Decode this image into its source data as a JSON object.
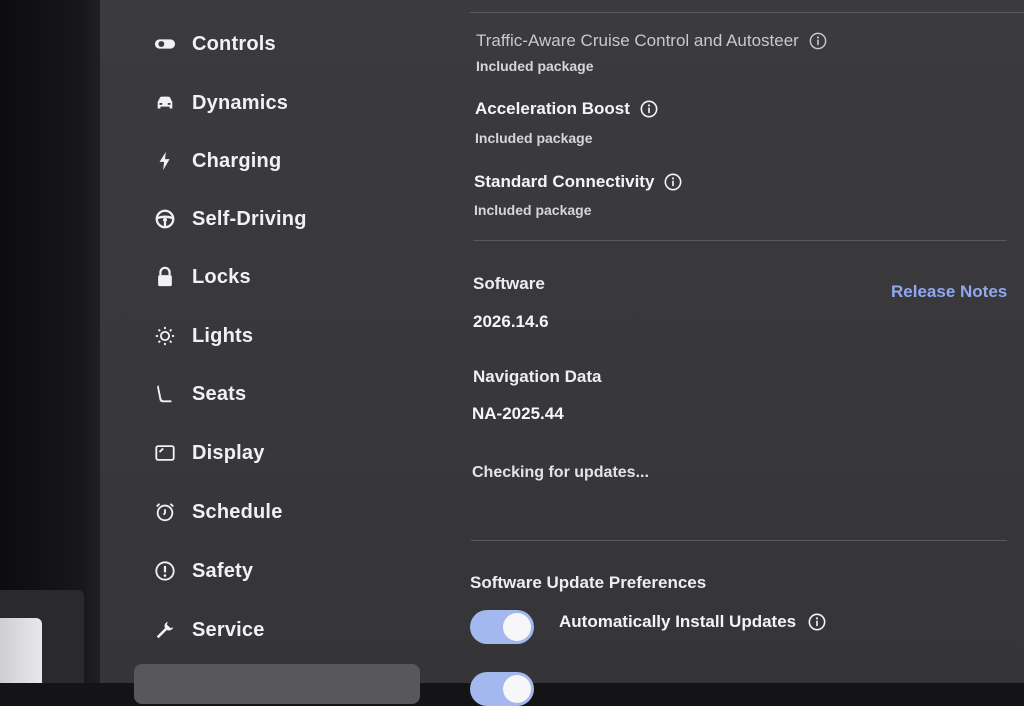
{
  "sidebar": {
    "items": [
      {
        "label": "Controls",
        "icon": "toggle-icon"
      },
      {
        "label": "Dynamics",
        "icon": "car-icon"
      },
      {
        "label": "Charging",
        "icon": "lightning-icon"
      },
      {
        "label": "Self-Driving",
        "icon": "steering-wheel-icon"
      },
      {
        "label": "Locks",
        "icon": "lock-icon"
      },
      {
        "label": "Lights",
        "icon": "light-bulb-icon"
      },
      {
        "label": "Seats",
        "icon": "seat-icon"
      },
      {
        "label": "Display",
        "icon": "display-icon"
      },
      {
        "label": "Schedule",
        "icon": "alarm-clock-icon"
      },
      {
        "label": "Safety",
        "icon": "alert-circle-icon"
      },
      {
        "label": "Service",
        "icon": "wrench-icon"
      }
    ]
  },
  "features": [
    {
      "title": "Traffic-Aware Cruise Control and Autosteer",
      "subtitle": "Included package"
    },
    {
      "title": "Acceleration Boost",
      "subtitle": "Included package"
    },
    {
      "title": "Standard Connectivity",
      "subtitle": "Included package"
    }
  ],
  "software": {
    "label": "Software",
    "version": "2026.14.6",
    "release_notes_label": "Release Notes",
    "navigation_label": "Navigation Data",
    "navigation_version": "NA-2025.44",
    "status": "Checking for updates..."
  },
  "preferences": {
    "heading": "Software Update Preferences",
    "auto_install_label": "Automatically Install Updates",
    "auto_install_enabled": true
  },
  "colors": {
    "accent": "#8fa8ef",
    "toggle_on": "#a3b8ee",
    "background": "#39393c"
  }
}
